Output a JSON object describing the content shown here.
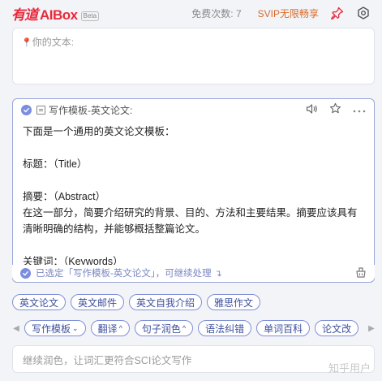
{
  "header": {
    "logo_main": "有道",
    "logo_sub": "AIBox",
    "beta": "Beta",
    "free_count": "免费次数: 7",
    "svip": "SVIP无限畅享"
  },
  "input": {
    "placeholder": "你的文本:"
  },
  "result": {
    "title": "写作模板-英文论文:",
    "lines": [
      "下面是一个通用的英文论文模板：",
      "",
      "标题：（Title）",
      "",
      "摘要：（Abstract）",
      "在这一部分，简要介绍研究的背景、目的、方法和主要结果。摘要应该具有清晰明确的结构，并能够概括整篇论文。",
      "",
      "关键词：（Keywords）"
    ],
    "footer": "已选定「写作模板-英文论文」，可继续处理"
  },
  "chips_row1": [
    "英文论文",
    "英文邮件",
    "英文自我介绍",
    "雅思作文"
  ],
  "chips_row2": [
    {
      "label": "写作模板",
      "dropdown": true
    },
    {
      "label": "翻译",
      "dropdown": true
    },
    {
      "label": "句子润色",
      "dropdown": true
    },
    {
      "label": "语法纠错",
      "dropdown": false
    },
    {
      "label": "单词百科",
      "dropdown": false
    },
    {
      "label": "论文改",
      "dropdown": false
    }
  ],
  "bottom_input": {
    "placeholder": "继续润色，让词汇更符合SCI论文写作"
  },
  "watermark": "知乎用户",
  "icons": {
    "pin": "pin-icon",
    "settings": "settings-icon",
    "location": "location-pin-icon",
    "check": "check-circle-icon",
    "doc": "document-icon",
    "speaker": "speaker-icon",
    "star": "star-icon",
    "more": "more-icon",
    "clear": "clear-icon"
  },
  "colors": {
    "brand": "#e8293b",
    "accent": "#7f8fd6",
    "svip": "#d86a2a"
  }
}
